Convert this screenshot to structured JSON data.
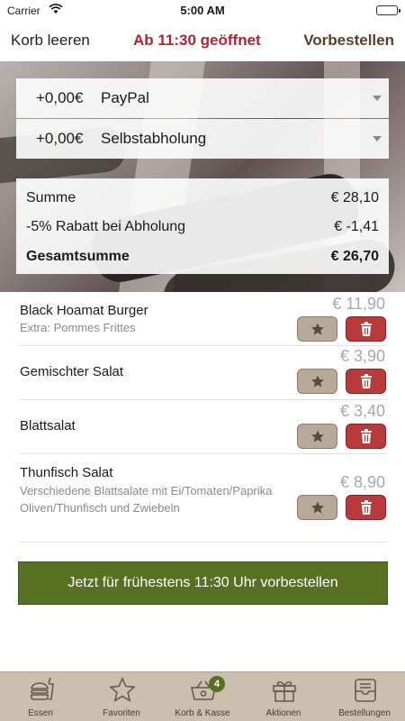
{
  "status": {
    "carrier": "Carrier",
    "time": "5:00 AM"
  },
  "nav": {
    "left": "Korb leeren",
    "center": "Ab 11:30 geöffnet",
    "right": "Vorbestellen"
  },
  "payment": {
    "amount": "+0,00€",
    "label": "PayPal"
  },
  "delivery": {
    "amount": "+0,00€",
    "label": "Selbstabholung"
  },
  "summary": {
    "sum_label": "Summe",
    "sum_value": "€ 28,10",
    "discount_label": "-5% Rabatt bei Abholung",
    "discount_value": "€ -1,41",
    "total_label": "Gesamtsumme",
    "total_value": "€ 26,70"
  },
  "items": [
    {
      "name": "Black Hoamat Burger",
      "sub": "Extra: Pommes Frittes",
      "price": "€ 11,90"
    },
    {
      "name": "Gemischter Salat",
      "sub": "",
      "price": "€ 3,90"
    },
    {
      "name": "Blattsalat",
      "sub": "",
      "price": "€ 3,40"
    },
    {
      "name": "Thunfisch Salat",
      "sub": "Verschiedene Blattsalate mit Ei/Tomaten/Paprika Oliven/Thunfisch und Zwiebeln",
      "price": "€ 8,90"
    }
  ],
  "order_button": "Jetzt für frühestens 11:30 Uhr vorbestellen",
  "tabs": [
    {
      "label": "Essen",
      "icon": "burger-icon"
    },
    {
      "label": "Favoriten",
      "icon": "star-icon"
    },
    {
      "label": "Korb & Kasse",
      "icon": "basket-icon",
      "badge": "4"
    },
    {
      "label": "Aktionen",
      "icon": "gift-icon"
    },
    {
      "label": "Bestellungen",
      "icon": "inbox-icon"
    }
  ],
  "colors": {
    "accent_red": "#b3232a",
    "brand_brown": "#5a3e2a",
    "order_green": "#587022",
    "tabbar": "#cbbfae"
  }
}
